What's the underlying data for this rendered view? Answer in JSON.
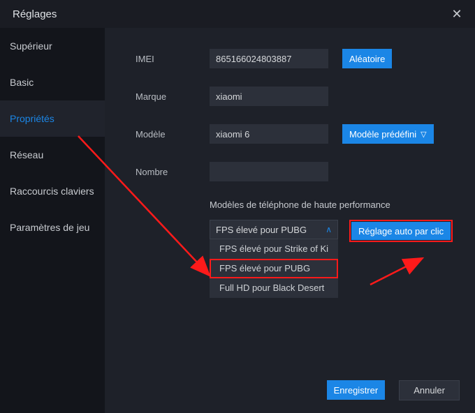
{
  "titlebar": {
    "title": "Réglages"
  },
  "sidebar": {
    "items": [
      {
        "label": "Supérieur"
      },
      {
        "label": "Basic"
      },
      {
        "label": "Propriétés"
      },
      {
        "label": "Réseau"
      },
      {
        "label": "Raccourcis claviers"
      },
      {
        "label": "Paramètres de jeu"
      }
    ]
  },
  "form": {
    "imei": {
      "label": "IMEI",
      "value": "865166024803887",
      "random_btn": "Aléatoire"
    },
    "brand": {
      "label": "Marque",
      "value": "xiaomi"
    },
    "model": {
      "label": "Modèle",
      "value": "xiaomi 6",
      "preset_btn": "Modèle prédéfini"
    },
    "number": {
      "label": "Nombre",
      "value": ""
    }
  },
  "perf": {
    "section_label": "Modèles de téléphone de haute performance",
    "selected": "FPS élevé pour PUBG",
    "options": [
      "FPS élevé pour Strike of Ki",
      "FPS élevé pour PUBG",
      "Full HD pour Black Desert"
    ],
    "auto_btn": "Réglage auto par clic"
  },
  "footer": {
    "save": "Enregistrer",
    "cancel": "Annuler"
  }
}
